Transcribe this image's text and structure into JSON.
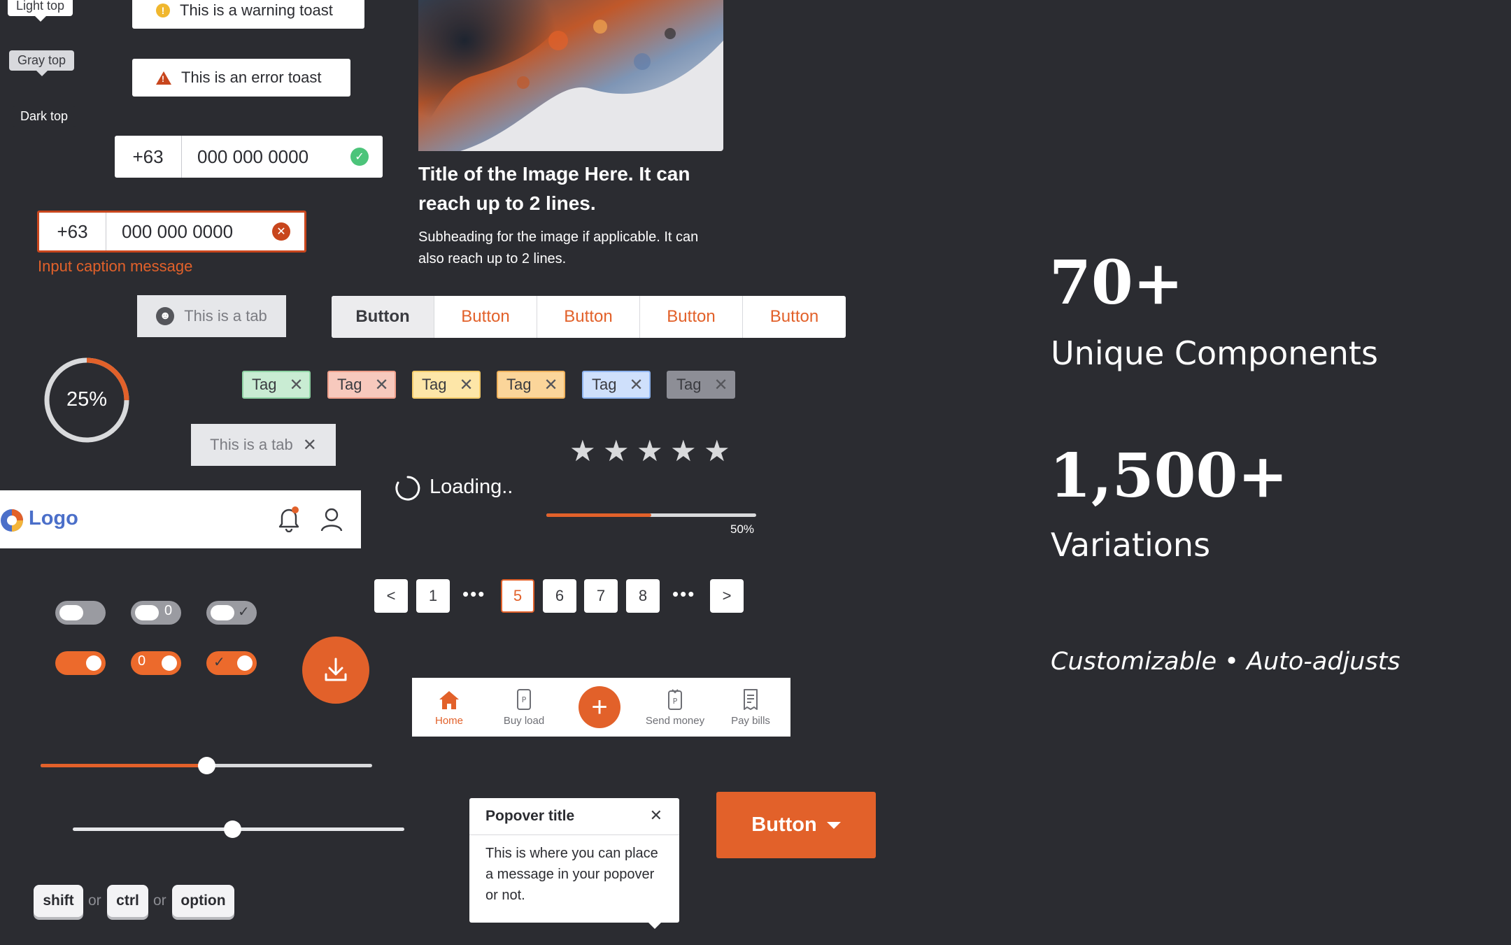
{
  "tooltips": {
    "light": "Light top",
    "gray": "Gray top",
    "dark": "Dark top"
  },
  "toasts": {
    "warning": "This is a warning toast",
    "error": "This is an error toast"
  },
  "phone_ok": {
    "country_code": "+63",
    "number": "000 000 0000"
  },
  "phone_err": {
    "country_code": "+63",
    "number": "000 000 0000",
    "caption": "Input caption message"
  },
  "image_card": {
    "title": "Title of the Image Here. It can reach up to 2 lines.",
    "subtitle": "Subheading for the image if applicable. It can also reach up to 2 lines."
  },
  "tab_icon": {
    "label": "This is a tab"
  },
  "tab_close": {
    "label": "This is a tab"
  },
  "button_group": {
    "buttons": [
      "Button",
      "Button",
      "Button",
      "Button",
      "Button"
    ]
  },
  "progress_ring": {
    "label": "25%",
    "value": 0.25
  },
  "tags": [
    {
      "label": "Tag",
      "bg": "#c9ecd3",
      "border": "#8fd3a4"
    },
    {
      "label": "Tag",
      "bg": "#f7c9bd",
      "border": "#ef9f8a"
    },
    {
      "label": "Tag",
      "bg": "#fde6a8",
      "border": "#f5cc6a"
    },
    {
      "label": "Tag",
      "bg": "#fbd59a",
      "border": "#f0b25c"
    },
    {
      "label": "Tag",
      "bg": "#cfe0fb",
      "border": "#8fb5f0"
    },
    {
      "label": "Tag",
      "bg": "#8d8e96",
      "border": "#8d8e96"
    }
  ],
  "rating": {
    "stars": 5
  },
  "loading": {
    "label": "Loading.."
  },
  "progress_bar": {
    "label": "50%",
    "value": 0.5
  },
  "header": {
    "logo": "Logo"
  },
  "pagination": {
    "prev": "<",
    "pages": [
      "1",
      "5",
      "6",
      "7",
      "8"
    ],
    "current": "5",
    "ellipsis": "•••",
    "next": ">"
  },
  "toggles": {
    "off_number": "0",
    "on_number": "0"
  },
  "bottom_nav": {
    "items": [
      "Home",
      "Buy load",
      "Send money",
      "Pay bills"
    ]
  },
  "sliders": {
    "slider1_value": 0.5,
    "slider2_value": 0.48
  },
  "popover": {
    "title": "Popover title",
    "body": "This is where you can place a message in your popover or not."
  },
  "dropdown_button": {
    "label": "Button"
  },
  "keys": {
    "shift": "shift",
    "ctrl": "ctrl",
    "option": "option",
    "or": "or"
  },
  "stats": {
    "components_value": "70+",
    "components_label": "Unique Components",
    "variations_value": "1,500+",
    "variations_label": "Variations",
    "tagline": "Customizable • Auto-adjusts"
  },
  "colors": {
    "accent": "#e2612a",
    "background": "#2b2c31",
    "error": "#c8461d",
    "success": "#4cc47a",
    "warning": "#f0b72e"
  }
}
